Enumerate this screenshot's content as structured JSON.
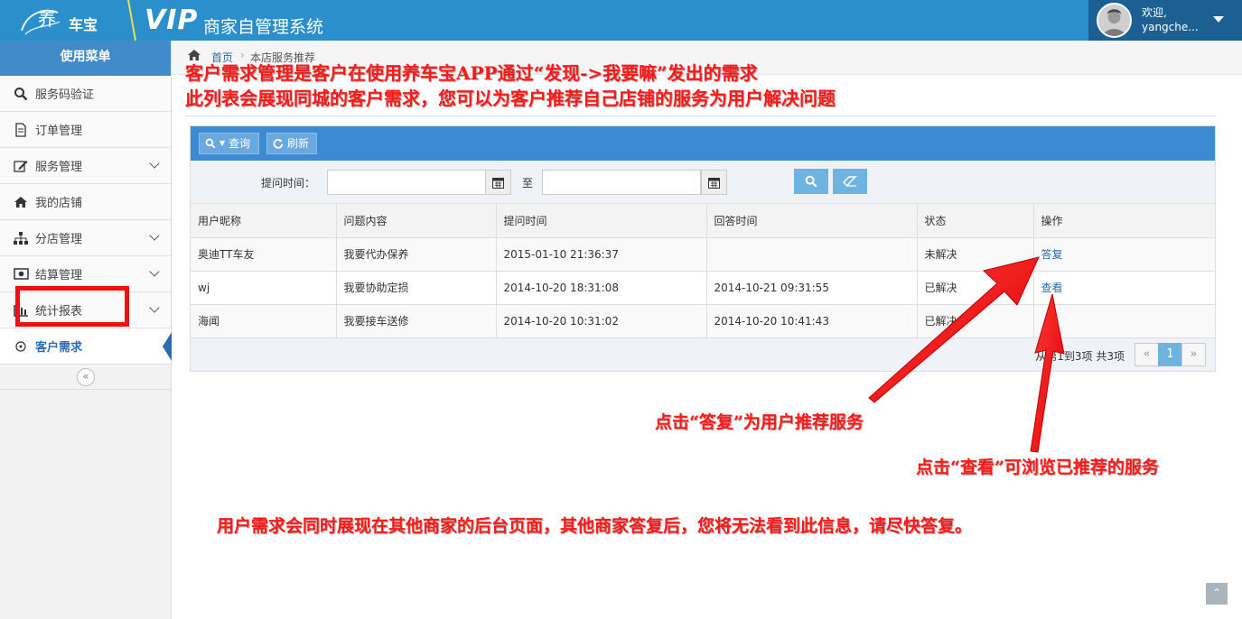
{
  "header": {
    "logo_text": "车宝",
    "logo_char": "养",
    "vip": "VIP",
    "system_title": "商家自管理系统",
    "welcome": "欢迎,",
    "username": "yangche..."
  },
  "sidebar": {
    "title": "使用菜单",
    "items": [
      {
        "label": "服务码验证",
        "icon": "search-icon"
      },
      {
        "label": "订单管理",
        "icon": "document-icon"
      },
      {
        "label": "服务管理",
        "icon": "edit-icon"
      },
      {
        "label": "我的店铺",
        "icon": "home-icon"
      },
      {
        "label": "分店管理",
        "icon": "sitemap-icon"
      },
      {
        "label": "结算管理",
        "icon": "money-icon"
      },
      {
        "label": "统计报表",
        "icon": "bar-chart-icon"
      },
      {
        "label": "客户需求",
        "icon": "circle-icon"
      }
    ],
    "collapse_glyph": "«"
  },
  "breadcrumb": {
    "home": "首页",
    "separator": "›",
    "current": "本店服务推荐"
  },
  "annotations": {
    "line1": "客户需求管理是客户在使用养车宝APP通过“发现->我要嘛”发出的需求",
    "line2": "此列表会展现同城的客户需求，您可以为客户推荐自己店铺的服务为用户解决问题",
    "reply_hint": "点击“答复”为用户推荐服务",
    "view_hint": "点击“查看”可浏览已推荐的服务",
    "footer_note": "用户需求会同时展现在其他商家的后台页面，其他商家答复后，您将无法看到此信息，请尽快答复。"
  },
  "toolbar": {
    "query_label": "查询",
    "refresh_label": "刷新"
  },
  "filter": {
    "label": "提问时间：",
    "to": "至",
    "start_value": "",
    "end_value": ""
  },
  "table": {
    "headers": [
      "用户昵称",
      "问题内容",
      "提问时间",
      "回答时间",
      "状态",
      "操作"
    ],
    "rows": [
      {
        "nickname": "奥迪TT车友",
        "content": "我要代办保养",
        "asked": "2015-01-10 21:36:37",
        "answered": "",
        "status": "未解决",
        "action": "答复"
      },
      {
        "nickname": "wj",
        "content": "我要协助定损",
        "asked": "2014-10-20 18:31:08",
        "answered": "2014-10-21 09:31:55",
        "status": "已解决",
        "action": "查看"
      },
      {
        "nickname": "海闻",
        "content": "我要接车送修",
        "asked": "2014-10-20 10:31:02",
        "answered": "2014-10-20 10:41:43",
        "status": "已解决",
        "action": ""
      }
    ]
  },
  "pager": {
    "info": "从第1到3项 共3项",
    "prev": "«",
    "current": "1",
    "next": "»"
  },
  "scroll_top_glyph": "⌃",
  "colors": {
    "topbar": "#2b8fcb",
    "annotation": "#ff1a1a",
    "link": "#2b6cb0",
    "toolbar": "#3d8ad4"
  }
}
